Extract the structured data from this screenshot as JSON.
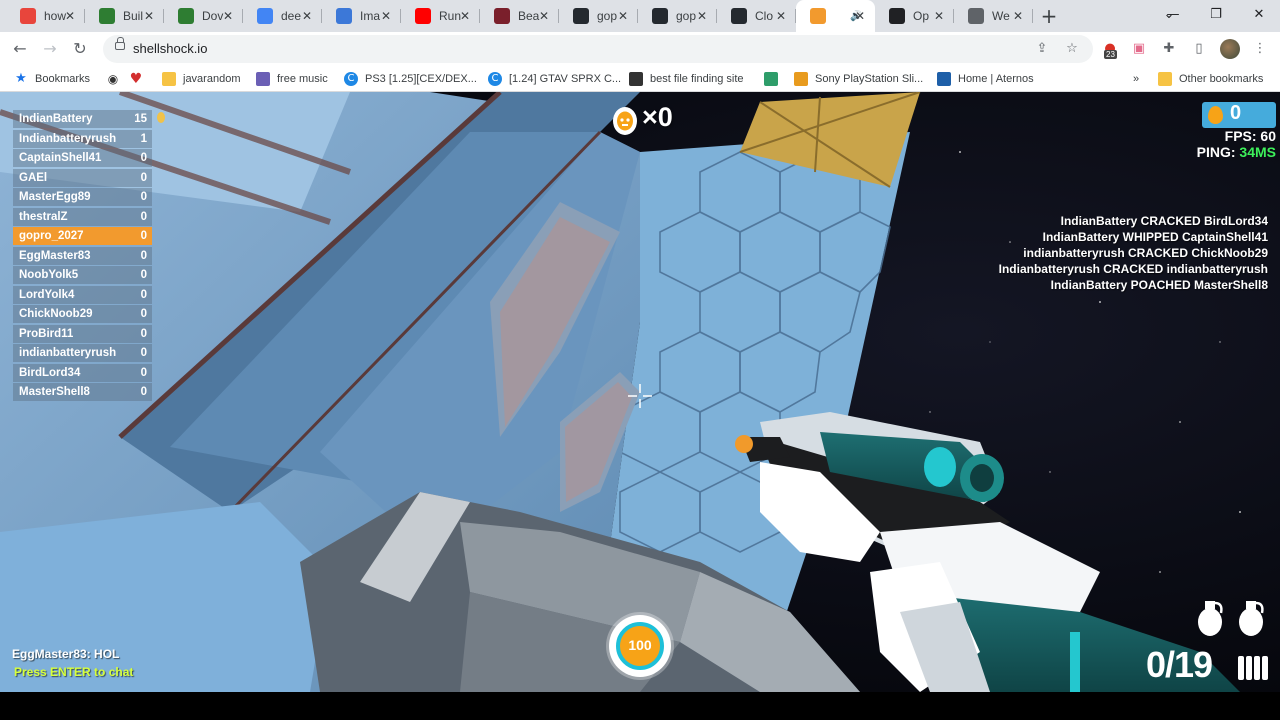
{
  "browser": {
    "tabs": [
      {
        "title": "how",
        "favicon": "google-multicolor-icon",
        "color": "#e8453c"
      },
      {
        "title": "Buil",
        "favicon": "minecraft-icon",
        "color": "#2e7d32"
      },
      {
        "title": "Dov",
        "favicon": "minecraft-icon",
        "color": "#2e7d32"
      },
      {
        "title": "dee",
        "favicon": "google-icon",
        "color": "#4285f4"
      },
      {
        "title": "Ima",
        "favicon": "chart-line-icon",
        "color": "#3c78d8"
      },
      {
        "title": "Run",
        "favicon": "youtube-icon",
        "color": "#ff0000"
      },
      {
        "title": "Bea",
        "favicon": "m-letter-icon",
        "color": "#7a1f2b"
      },
      {
        "title": "gop",
        "favicon": "github-icon",
        "color": "#24292f"
      },
      {
        "title": "gop",
        "favicon": "github-icon",
        "color": "#24292f"
      },
      {
        "title": "Clo",
        "favicon": "github-icon",
        "color": "#24292f"
      },
      {
        "title": "",
        "favicon": "shellshock-icon",
        "color": "#f29a2e",
        "active": true,
        "audio": true
      },
      {
        "title": "Op",
        "favicon": "chatgpt-icon",
        "color": "#202124"
      },
      {
        "title": "We",
        "favicon": "globe-icon",
        "color": "#5f6368"
      }
    ],
    "close_glyph": "✕",
    "new_tab_glyph": "+",
    "url": "shellshock.io",
    "extension_badge": "23",
    "bookmarks": [
      {
        "label": "Bookmarks",
        "icon": "star-icon",
        "color": "#1a73e8"
      },
      {
        "label": "",
        "icon": "globe-icon",
        "color": "#333"
      },
      {
        "label": "",
        "icon": "heart-icon",
        "color": "#d32f2f"
      },
      {
        "label": "javarandom",
        "icon": "folder-icon",
        "color": "#f6c344"
      },
      {
        "label": "free music",
        "icon": "alien-icon",
        "color": "#6b5fb5"
      },
      {
        "label": "PS3 [1.25][CEX/DEX...",
        "icon": "c-icon",
        "color": "#1e88e5"
      },
      {
        "label": "[1.24] GTAV SPRX C...",
        "icon": "c-icon",
        "color": "#1e88e5"
      },
      {
        "label": "best file finding site",
        "icon": "robot-icon",
        "color": "#333"
      },
      {
        "label": "",
        "icon": "sheet-icon",
        "color": "#2e9d6a"
      },
      {
        "label": "Sony PlayStation Sli...",
        "icon": "bag-icon",
        "color": "#e89b1e"
      },
      {
        "label": "Home | Aternos",
        "icon": "aternos-icon",
        "color": "#1e5fa8"
      }
    ],
    "bookmarks_overflow": "»",
    "other_bookmarks": "Other bookmarks"
  },
  "game": {
    "scoreboard": [
      {
        "name": "IndianBattery",
        "score": "15"
      },
      {
        "name": "Indianbatteryrush",
        "score": "1"
      },
      {
        "name": "CaptainShell41",
        "score": "0"
      },
      {
        "name": "GAEl",
        "score": "0"
      },
      {
        "name": "MasterEgg89",
        "score": "0"
      },
      {
        "name": "thestralZ",
        "score": "0"
      },
      {
        "name": "gopro_2027",
        "score": "0",
        "me": true
      },
      {
        "name": "EggMaster83",
        "score": "0"
      },
      {
        "name": "NoobYolk5",
        "score": "0"
      },
      {
        "name": "LordYolk4",
        "score": "0"
      },
      {
        "name": "ChickNoob29",
        "score": "0"
      },
      {
        "name": "ProBird11",
        "score": "0"
      },
      {
        "name": "indianbatteryrush",
        "score": "0"
      },
      {
        "name": "BirdLord34",
        "score": "0"
      },
      {
        "name": "MasterShell8",
        "score": "0"
      }
    ],
    "kill_streak": "×0",
    "coins": "0",
    "fps_label": "FPS: 60",
    "ping_label": "PING: ",
    "ping_value": "34MS",
    "ping_color": "#3df05a",
    "kill_feed": [
      "IndianBattery CRACKED BirdLord34",
      "IndianBattery WHIPPED CaptainShell41",
      "indianbatteryrush CRACKED ChickNoob29",
      "Indianbatteryrush CRACKED indianbatteryrush",
      "IndianBattery POACHED MasterShell8"
    ],
    "chat_message": "EggMaster83: HOL",
    "chat_hint": "Press ENTER to chat",
    "health": 100,
    "health_label": "100",
    "ammo": "0/19",
    "grenades": 2
  }
}
